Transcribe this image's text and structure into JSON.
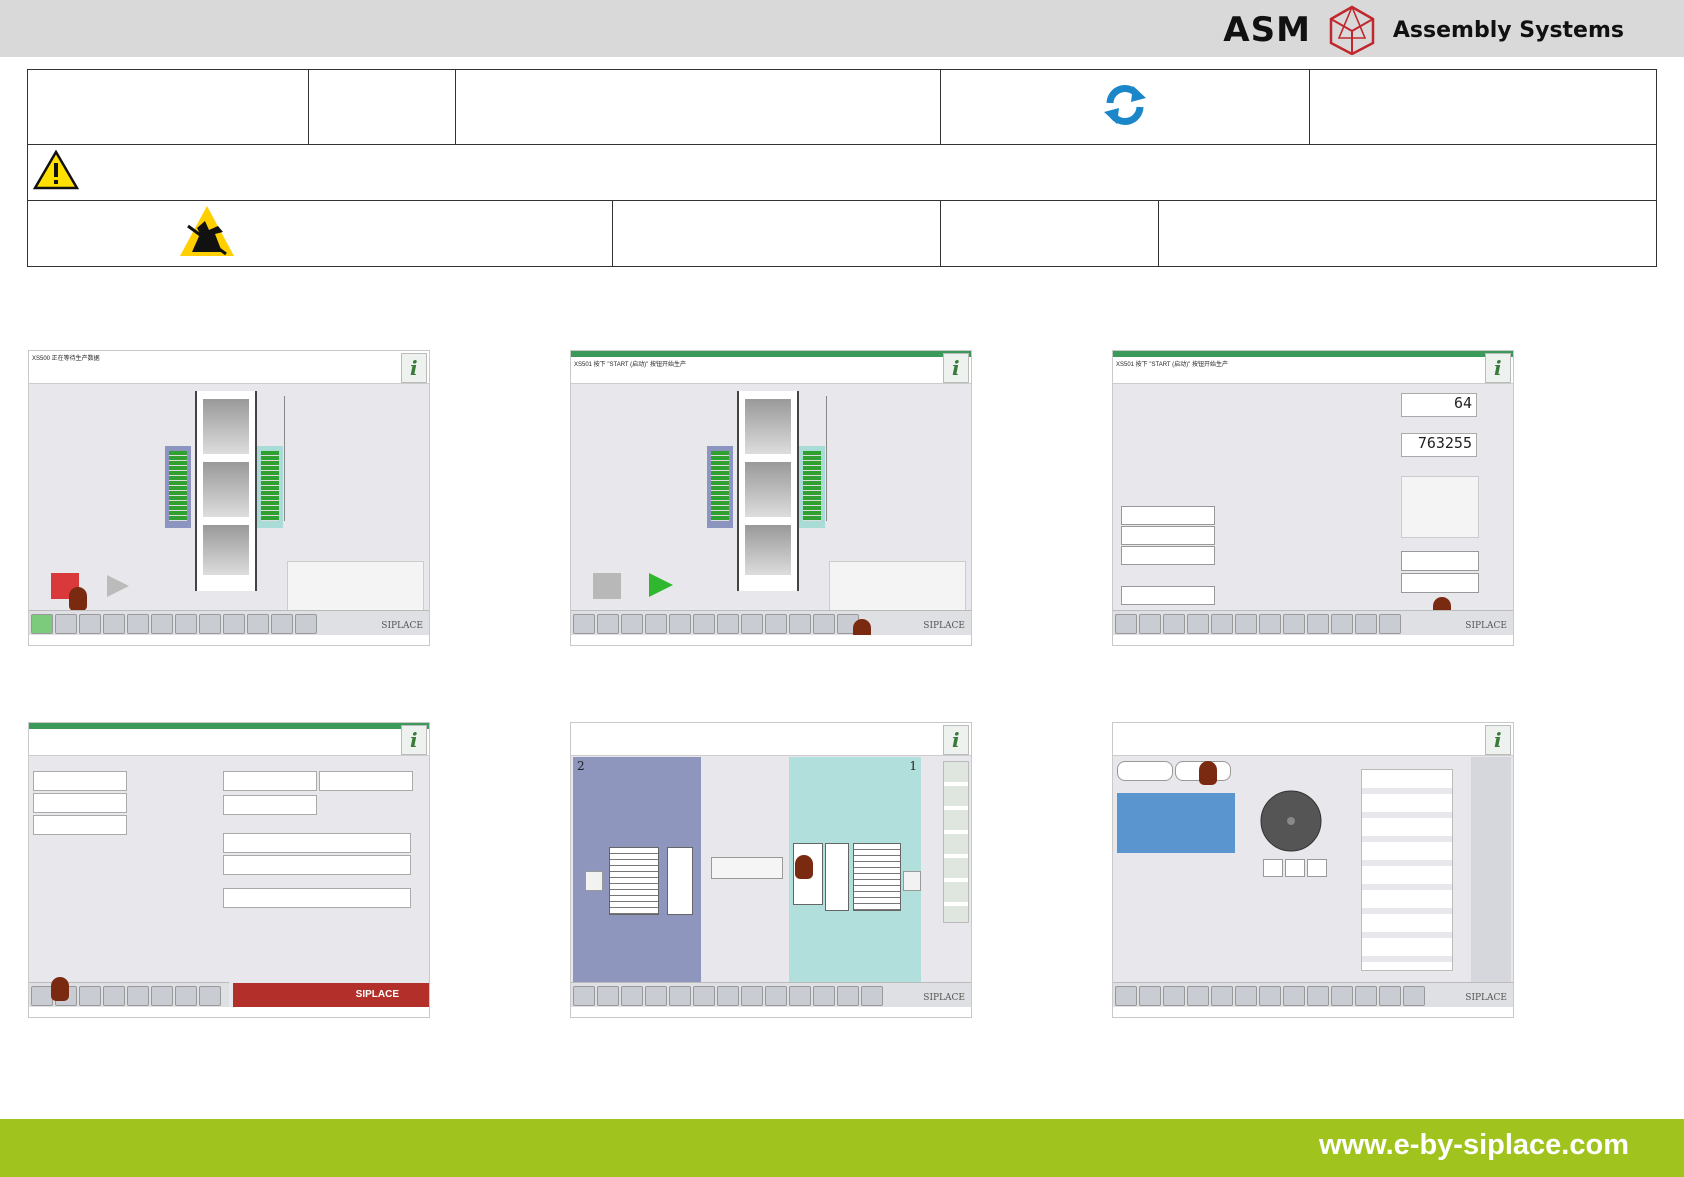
{
  "header": {
    "brand": "ASM",
    "brand_subtitle": "Assembly Systems"
  },
  "footer": {
    "url": "www.e-by-siplace.com"
  },
  "screens": [
    {
      "title": "XS500 正在等待生产数据",
      "brand": "SIPLACE"
    },
    {
      "title": "XS501 按下 \"START (启动)\" 按钮开始生产",
      "brand": "SIPLACE"
    },
    {
      "title": "XS501 按下 \"START (启动)\" 按钮开始生产",
      "brand": "SIPLACE",
      "counter1": "64",
      "counter2": "763255"
    },
    {
      "title": "",
      "brand": "SIPLACE"
    },
    {
      "title": "",
      "brand": "SIPLACE",
      "left_num": "2",
      "right_num": "1"
    },
    {
      "title": "",
      "brand": "SIPLACE"
    }
  ],
  "colors": {
    "accent_green": "#a0c41d",
    "header_grey": "#d9d9d9",
    "sync_blue": "#1b87c9"
  }
}
